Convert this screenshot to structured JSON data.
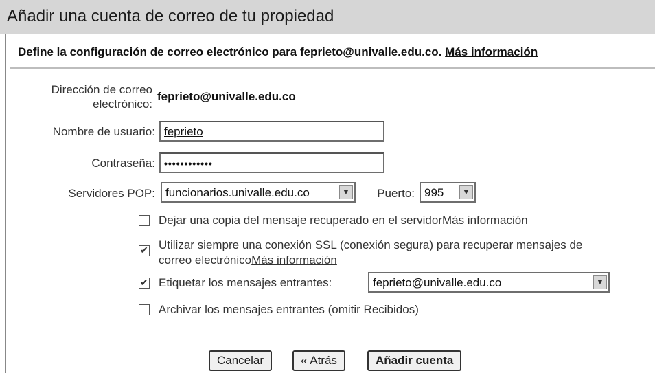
{
  "title": "Añadir una cuenta de correo de tu propiedad",
  "subheading": {
    "text": "Define la configuración de correo electrónico para feprieto@univalle.edu.co.",
    "link": "Más información"
  },
  "fields": {
    "email_label_line1": "Dirección de correo",
    "email_label_line2": "electrónico:",
    "email_value": "feprieto@univalle.edu.co",
    "username_label": "Nombre de usuario:",
    "username_value": "feprieto",
    "password_label": "Contraseña:",
    "password_value": "••••••••••••",
    "pop_label": "Servidores POP:",
    "pop_value": "funcionarios.univalle.edu.co",
    "port_label": "Puerto:",
    "port_value": "995"
  },
  "options": {
    "leave_copy": {
      "checked": false,
      "text": "Dejar una copia del mensaje recuperado en el servidor",
      "link": "Más información"
    },
    "ssl": {
      "checked": true,
      "text_line1": "Utilizar siempre una conexión SSL (conexión segura) para recuperar mensajes de",
      "text_line2": "correo electrónico",
      "link": "Más información"
    },
    "label_incoming": {
      "checked": true,
      "text": "Etiquetar los mensajes entrantes:",
      "select_value": "feprieto@univalle.edu.co"
    },
    "archive": {
      "checked": false,
      "text": "Archivar los mensajes entrantes (omitir Recibidos)"
    }
  },
  "buttons": {
    "cancel": "Cancelar",
    "back": "« Atrás",
    "add": "Añadir cuenta"
  },
  "icons": {
    "checkmark": "✔",
    "dropdown": "▼"
  }
}
